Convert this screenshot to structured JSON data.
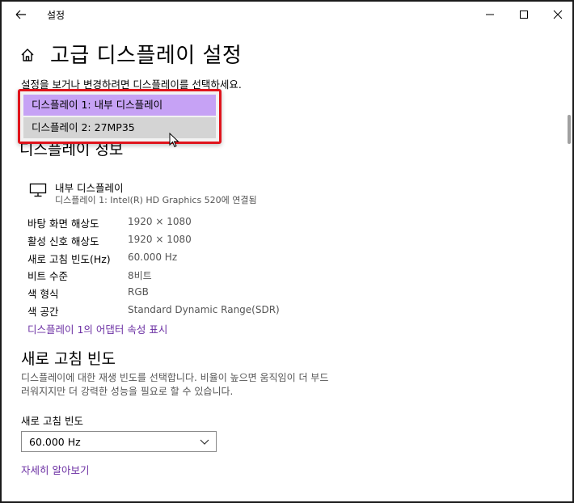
{
  "window": {
    "title": "설정",
    "back_icon": "arrow-left-icon",
    "minimize_icon": "minimize-icon",
    "maximize_icon": "maximize-icon",
    "close_icon": "close-icon"
  },
  "header": {
    "home_icon": "home-icon",
    "title": "고급 디스플레이 설정"
  },
  "instruction": "설정을 보거나 변경하려면 디스플레이를 선택하세요.",
  "display_dropdown": {
    "options": [
      {
        "label": "디스플레이 1: 내부 디스플레이"
      },
      {
        "label": "디스플레이 2: 27MP35"
      }
    ],
    "highlight_color": "#c6a2f5",
    "outline_color": "#e0141c"
  },
  "display_info": {
    "heading": "디스플레이 정보",
    "monitor_icon": "monitor-icon",
    "name": "내부 디스플레이",
    "connection": "디스플레이 1: Intel(R) HD Graphics 520에 연결됨",
    "rows": [
      {
        "label": "바탕 화면 해상도",
        "value": "1920 × 1080"
      },
      {
        "label": "활성 신호 해상도",
        "value": "1920 × 1080"
      },
      {
        "label": "새로 고침 빈도(Hz)",
        "value": "60.000 Hz"
      },
      {
        "label": "비트 수준",
        "value": "8비트"
      },
      {
        "label": "색 형식",
        "value": "RGB"
      },
      {
        "label": "색 공간",
        "value": "Standard Dynamic Range(SDR)"
      }
    ],
    "adapter_link": "디스플레이 1의 어댑터 속성 표시"
  },
  "refresh_rate": {
    "heading": "새로 고침 빈도",
    "description": "디스플레이에 대한 재생 빈도를 선택합니다. 비율이 높으면 움직임이 더 부드러워지지만 더 강력한 성능을 필요로 할 수 있습니다.",
    "field_label": "새로 고침 빈도",
    "selected": "60.000 Hz",
    "learn_more": "자세히 알아보기"
  },
  "colors": {
    "link": "#6b2fa3"
  }
}
